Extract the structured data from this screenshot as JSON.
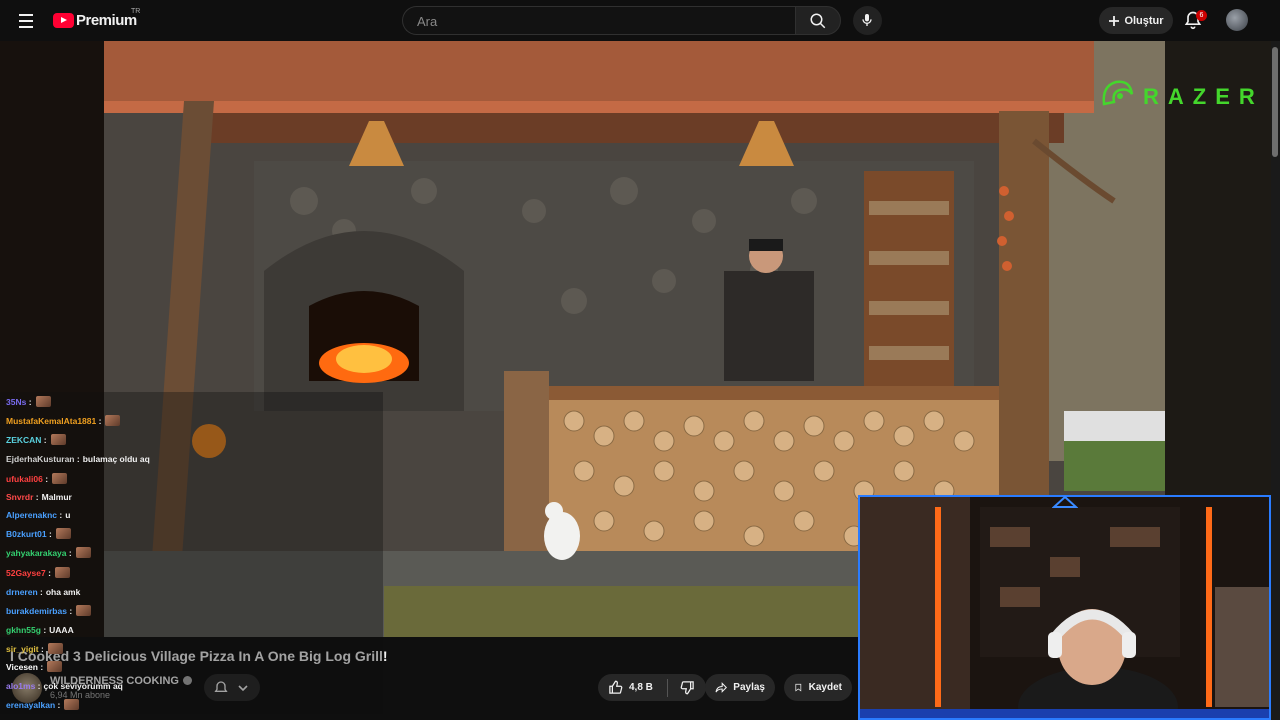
{
  "header": {
    "logo_text": "Premium",
    "country_code": "TR",
    "search_placeholder": "Ara",
    "create_label": "Oluştur",
    "notification_count": "6"
  },
  "video": {
    "overlay_brand": "RAZER",
    "title": "I Cooked 3 Delicious Village Pizza In A One Big Log Grill!",
    "channel_name": "WILDERNESS COOKING",
    "subscribers": "6,94 Mn abone",
    "like_count": "4,8 B",
    "share_label": "Paylaş",
    "save_label": "Kaydet"
  },
  "chat": {
    "messages": [
      {
        "user": "35Ns",
        "message": "",
        "color": "#7a6cf0"
      },
      {
        "user": "MustafaKemalAta1881",
        "message": "",
        "color": "#f0a020"
      },
      {
        "user": "ZEKCAN",
        "message": "",
        "color": "#5ad2e0"
      },
      {
        "user": "EjderhaKusturan",
        "message": "bulamaç oldu aq",
        "color": "#d0d0d0"
      },
      {
        "user": "ufukali06",
        "message": "",
        "color": "#ff4040"
      },
      {
        "user": "Snvrdr",
        "message": "Malmur",
        "color": "#ff4a4a"
      },
      {
        "user": "Alperenaknc",
        "message": "u",
        "color": "#4aa0ff"
      },
      {
        "user": "B0zkurt01",
        "message": "",
        "color": "#4aa0ff"
      },
      {
        "user": "yahyakarakaya",
        "message": "",
        "color": "#34d070"
      },
      {
        "user": "52Gayse7",
        "message": "",
        "color": "#ff4040"
      },
      {
        "user": "drneren",
        "message": "oha amk",
        "color": "#4aa0ff"
      },
      {
        "user": "burakdemirbas",
        "message": "",
        "color": "#4aa0ff"
      },
      {
        "user": "gkhn55g",
        "message": "UAAA",
        "color": "#34d070"
      },
      {
        "user": "sir_yigit",
        "message": "",
        "color": "#e0c040"
      },
      {
        "user": "Vicesen",
        "message": "",
        "color": "#ffffff"
      },
      {
        "user": "alo1ms",
        "message": "çok seviyorumm aq",
        "color": "#9a7cf0"
      },
      {
        "user": "erenayalkan",
        "message": "",
        "color": "#4aa0ff"
      }
    ]
  }
}
